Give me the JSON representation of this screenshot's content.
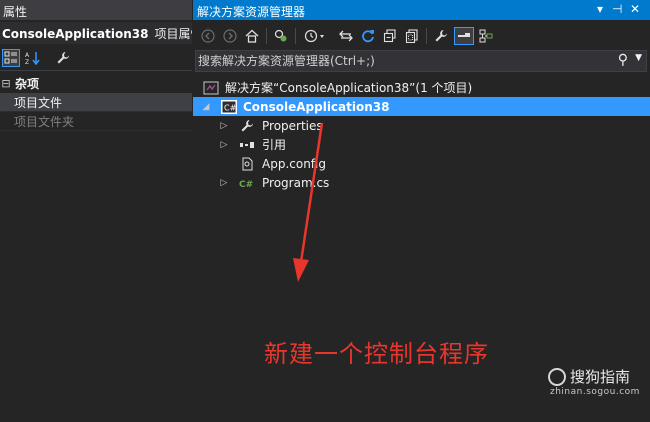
{
  "properties_panel": {
    "title": "属性",
    "object_name": "ConsoleApplication38",
    "object_type": "项目属性",
    "toolbar": {
      "categorized_icon": "categorized-icon",
      "alphabetical_icon": "alphabetical-sort-icon",
      "property_pages_icon": "wrench-icon"
    },
    "category": {
      "toggle": "⊟",
      "label": "杂项"
    },
    "properties": [
      {
        "label": "项目文件",
        "selected": true,
        "disabled": false
      },
      {
        "label": "项目文件夹",
        "selected": false,
        "disabled": true
      }
    ]
  },
  "solution_explorer": {
    "title": "解决方案资源管理器",
    "title_controls": {
      "dropdown": "▾",
      "pin": "⊣",
      "close": "✕"
    },
    "search": {
      "placeholder": "搜索解决方案资源管理器(Ctrl+;)",
      "value": ""
    },
    "tree": {
      "solution": "解决方案“ConsoleApplication38”(1 个项目)",
      "project": "ConsoleApplication38",
      "items": [
        {
          "label": "Properties",
          "icon": "wrench-icon",
          "expandable": true
        },
        {
          "label": "引用",
          "icon": "references-icon",
          "expandable": true
        },
        {
          "label": "App.config",
          "icon": "config-file-icon",
          "expandable": false
        },
        {
          "label": "Program.cs",
          "icon": "csharp-file-icon",
          "expandable": true
        }
      ]
    },
    "colors": {
      "selection": "#3399ff",
      "title_active": "#007acc"
    }
  },
  "annotation": {
    "text": "新建一个控制台程序",
    "color": "#e8362c"
  },
  "watermark": {
    "name": "搜狗指南",
    "url": "zhinan.sogou.com"
  }
}
